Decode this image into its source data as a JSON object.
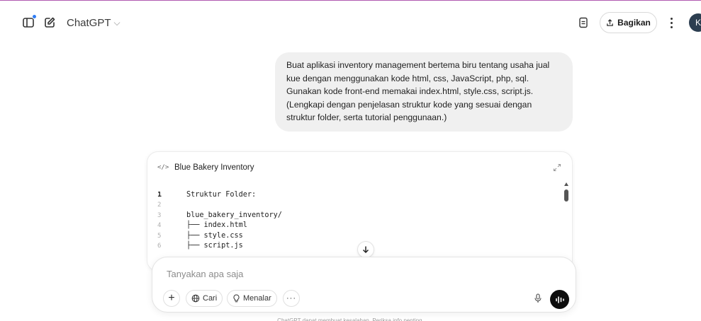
{
  "header": {
    "title": "ChatGPT",
    "share_label": "Bagikan",
    "avatar_initial": "K"
  },
  "user_message": {
    "lines": [
      "Buat aplikasi inventory management bertema biru tentang usaha jual",
      "kue dengan menggunakan kode html, css, JavaScript, php, sql.",
      "Gunakan kode front-end memakai index.html, style.css, script.js.",
      "(Lengkapi dengan penjelasan struktur kode yang sesuai dengan",
      "struktur folder, serta tutorial penggunaan.)"
    ]
  },
  "canvas": {
    "icon_glyph": "</>",
    "title": "Blue Bakery Inventory",
    "lines": [
      {
        "num": "1",
        "text": "Struktur Folder:"
      },
      {
        "num": "2",
        "text": ""
      },
      {
        "num": "3",
        "text": "blue_bakery_inventory/"
      },
      {
        "num": "4",
        "text": "├── index.html"
      },
      {
        "num": "5",
        "text": "├── style.css"
      },
      {
        "num": "6",
        "text": "├── script.js"
      }
    ]
  },
  "composer": {
    "placeholder": "Tanyakan apa saja",
    "tools": {
      "search_label": "Cari",
      "reason_label": "Menalar",
      "more_label": "···"
    }
  },
  "footer": {
    "note": "ChatGPT dapat membuat kesalahan. Periksa info penting."
  },
  "colors": {
    "accent_dot": "#2f7df6",
    "bubble_bg": "#f0f0f0",
    "voice_button": "#0d0d0d"
  }
}
